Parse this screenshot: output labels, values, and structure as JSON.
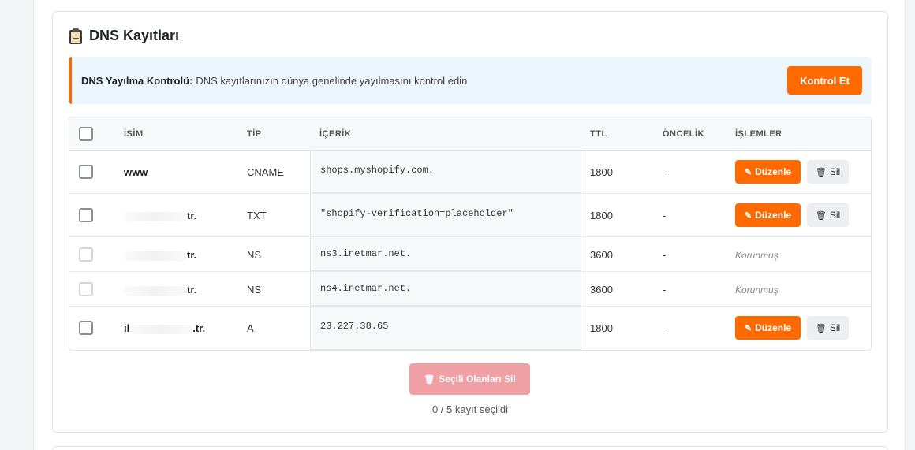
{
  "card": {
    "title": "DNS Kayıtları",
    "title_icon": "clipboard-icon"
  },
  "notice": {
    "bold": "DNS Yayılma Kontrolü:",
    "text": "DNS kayıtlarınızın dünya genelinde yayılmasını kontrol edin",
    "button": "Kontrol Et"
  },
  "table": {
    "headers": {
      "name": "İSİM",
      "type": "TİP",
      "content": "İÇERİK",
      "ttl": "TTL",
      "priority": "ÖNCELİK",
      "actions": "İŞLEMLER"
    },
    "rows": [
      {
        "name": "www",
        "type": "CNAME",
        "content": "shops.myshopify.com.",
        "ttl": "1800",
        "priority": "-",
        "edit": "Düzenle",
        "delete": "Sil"
      },
      {
        "name_suffix": "tr.",
        "type": "TXT",
        "content": "\"shopify-verification=placeholder\"",
        "ttl": "1800",
        "priority": "-",
        "edit": "Düzenle",
        "delete": "Sil"
      },
      {
        "name_suffix": "tr.",
        "type": "NS",
        "content": "ns3.inetmar.net.",
        "ttl": "3600",
        "priority": "-",
        "protected": "Korunmuş"
      },
      {
        "name_suffix": "tr.",
        "type": "NS",
        "content": "ns4.inetmar.net.",
        "ttl": "3600",
        "priority": "-",
        "protected": "Korunmuş"
      },
      {
        "name_prefix": "il",
        "name_suffix": ".tr.",
        "type": "A",
        "content": "23.227.38.65",
        "ttl": "1800",
        "priority": "-",
        "edit": "Düzenle",
        "delete": "Sil"
      }
    ]
  },
  "bulk": {
    "delete_selected": "Seçili Olanları Sil",
    "count_text": "0 / 5 kayıt seçildi"
  },
  "colors": {
    "accent": "#ff6a00",
    "notice_bg": "#eef6fd",
    "bulk_disabled": "#f0a0a5"
  }
}
